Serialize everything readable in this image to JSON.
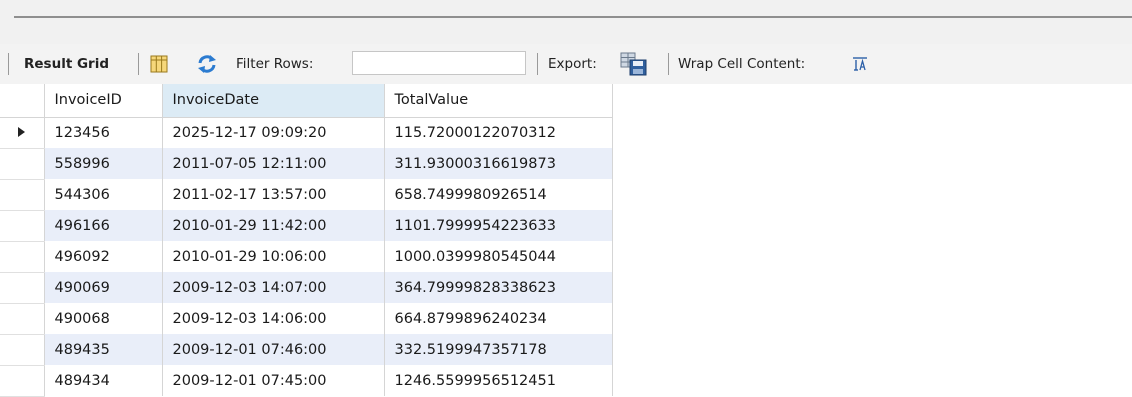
{
  "toolbar": {
    "result_grid_label": "Result Grid",
    "filter_label": "Filter Rows:",
    "filter_value": "",
    "export_label": "Export:",
    "wrap_label": "Wrap Cell Content:"
  },
  "grid": {
    "columns": [
      "InvoiceID",
      "InvoiceDate",
      "TotalValue"
    ],
    "sorted_column": "InvoiceDate",
    "current_row": 0,
    "rows": [
      {
        "id": "123456",
        "date": "2025-12-17 09:09:20",
        "total": "115.72000122070312"
      },
      {
        "id": "558996",
        "date": "2011-07-05 12:11:00",
        "total": "311.93000316619873"
      },
      {
        "id": "544306",
        "date": "2011-02-17 13:57:00",
        "total": "658.7499980926514"
      },
      {
        "id": "496166",
        "date": "2010-01-29 11:42:00",
        "total": "1101.7999954223633"
      },
      {
        "id": "496092",
        "date": "2010-01-29 10:06:00",
        "total": "1000.0399980545044"
      },
      {
        "id": "490069",
        "date": "2009-12-03 14:07:00",
        "total": "364.79999828338623"
      },
      {
        "id": "490068",
        "date": "2009-12-03 14:06:00",
        "total": "664.8799896240234"
      },
      {
        "id": "489435",
        "date": "2009-12-01 07:46:00",
        "total": "332.5199947357178"
      },
      {
        "id": "489434",
        "date": "2009-12-01 07:45:00",
        "total": "1246.5599956512451"
      }
    ]
  },
  "icons": {
    "grid_columns": "column-layout-icon",
    "refresh": "refresh-icon",
    "export": "export-save-icon",
    "wrap": "wrap-cell-icon",
    "current_row": "current-row-caret-icon"
  },
  "colors": {
    "sorted_header_bg": "#dcebf5",
    "alt_row_bg": "#e9eef9",
    "toolbar_bg": "#f3f3f3",
    "refresh_blue": "#2b7bd0"
  }
}
